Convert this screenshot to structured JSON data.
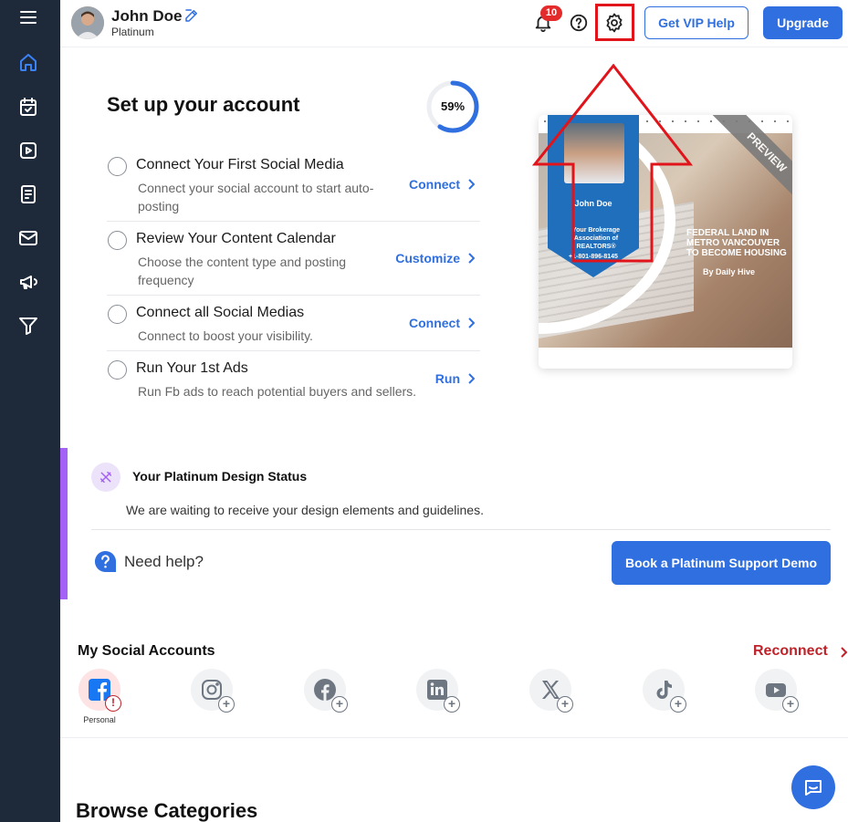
{
  "header": {
    "user_name": "John Doe",
    "user_plan": "Platinum",
    "notification_count": "10",
    "vip_label": "Get VIP Help",
    "upgrade_label": "Upgrade"
  },
  "setup": {
    "title": "Set up your account",
    "progress_text": "59%",
    "progress_value": 59,
    "tasks": [
      {
        "title": "Connect Your First Social Media",
        "desc": "Connect your social account to start auto-posting",
        "action": "Connect"
      },
      {
        "title": "Review Your Content Calendar",
        "desc": "Choose the content type and posting frequency",
        "action": "Customize"
      },
      {
        "title": "Connect all Social Medias",
        "desc": "Connect to boost your visibility.",
        "action": "Connect"
      },
      {
        "title": "Run Your 1st Ads",
        "desc": "Run Fb ads to reach potential buyers and sellers.",
        "action": "Run"
      }
    ]
  },
  "preview": {
    "agent_name": "John Doe",
    "brokerage": "Your Brokerage Association of REALTORS®",
    "phone": "+1-801-896-8145",
    "headline": "FEDERAL LAND IN METRO VANCOUVER TO BECOME HOUSING",
    "byline": "By Daily Hive",
    "ribbon": "PREVIEW"
  },
  "design_status": {
    "title": "Your Platinum Design Status",
    "desc": "We are waiting to receive your design elements and guidelines.",
    "need_help": "Need help?",
    "demo_button": "Book a Platinum Support Demo"
  },
  "social": {
    "title": "My Social Accounts",
    "reconnect": "Reconnect",
    "personal_label": "Personal",
    "accounts": [
      "facebook",
      "instagram",
      "facebook-page",
      "linkedin",
      "x",
      "tiktok",
      "youtube"
    ]
  },
  "browse": {
    "title": "Browse Categories"
  },
  "colors": {
    "accent": "#2f6fe0",
    "sidebar": "#1e2a3a",
    "danger": "#c0222a",
    "purple": "#a461f5"
  }
}
